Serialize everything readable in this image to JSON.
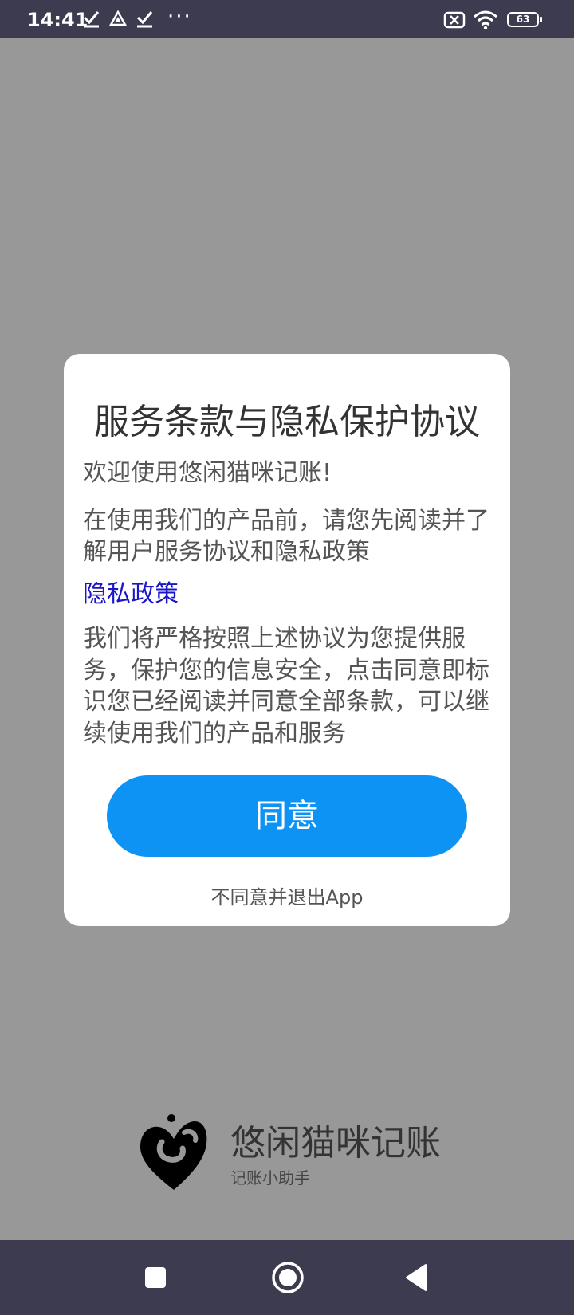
{
  "status_bar": {
    "time": "14:41",
    "more": "···",
    "battery": "63",
    "icons": [
      "check-icon",
      "drive-icon",
      "check-icon",
      "sim-x-icon",
      "wifi-icon",
      "battery-icon"
    ]
  },
  "dialog": {
    "title": "服务条款与隐私保护协议",
    "welcome": "欢迎使用悠闲猫咪记账!",
    "intro": "在使用我们的产品前，请您先阅读并了解用户服务协议和隐私政策",
    "privacy_link": "隐私政策",
    "body": "我们将严格按照上述协议为您提供服务，保护您的信息安全，点击同意即标识您已经阅读并同意全部条款，可以继续使用我们的产品和服务",
    "agree_button": "同意",
    "disagree_link": "不同意并退出App"
  },
  "brand": {
    "name": "悠闲猫咪记账",
    "tagline": "记账小助手"
  },
  "nav_bar": {
    "buttons": [
      "recents-icon",
      "home-icon",
      "back-icon"
    ]
  },
  "colors": {
    "overlay": "#989898",
    "system_bar": "#3c3b50",
    "accent": "#0d93f4",
    "link": "#1a16c8"
  }
}
